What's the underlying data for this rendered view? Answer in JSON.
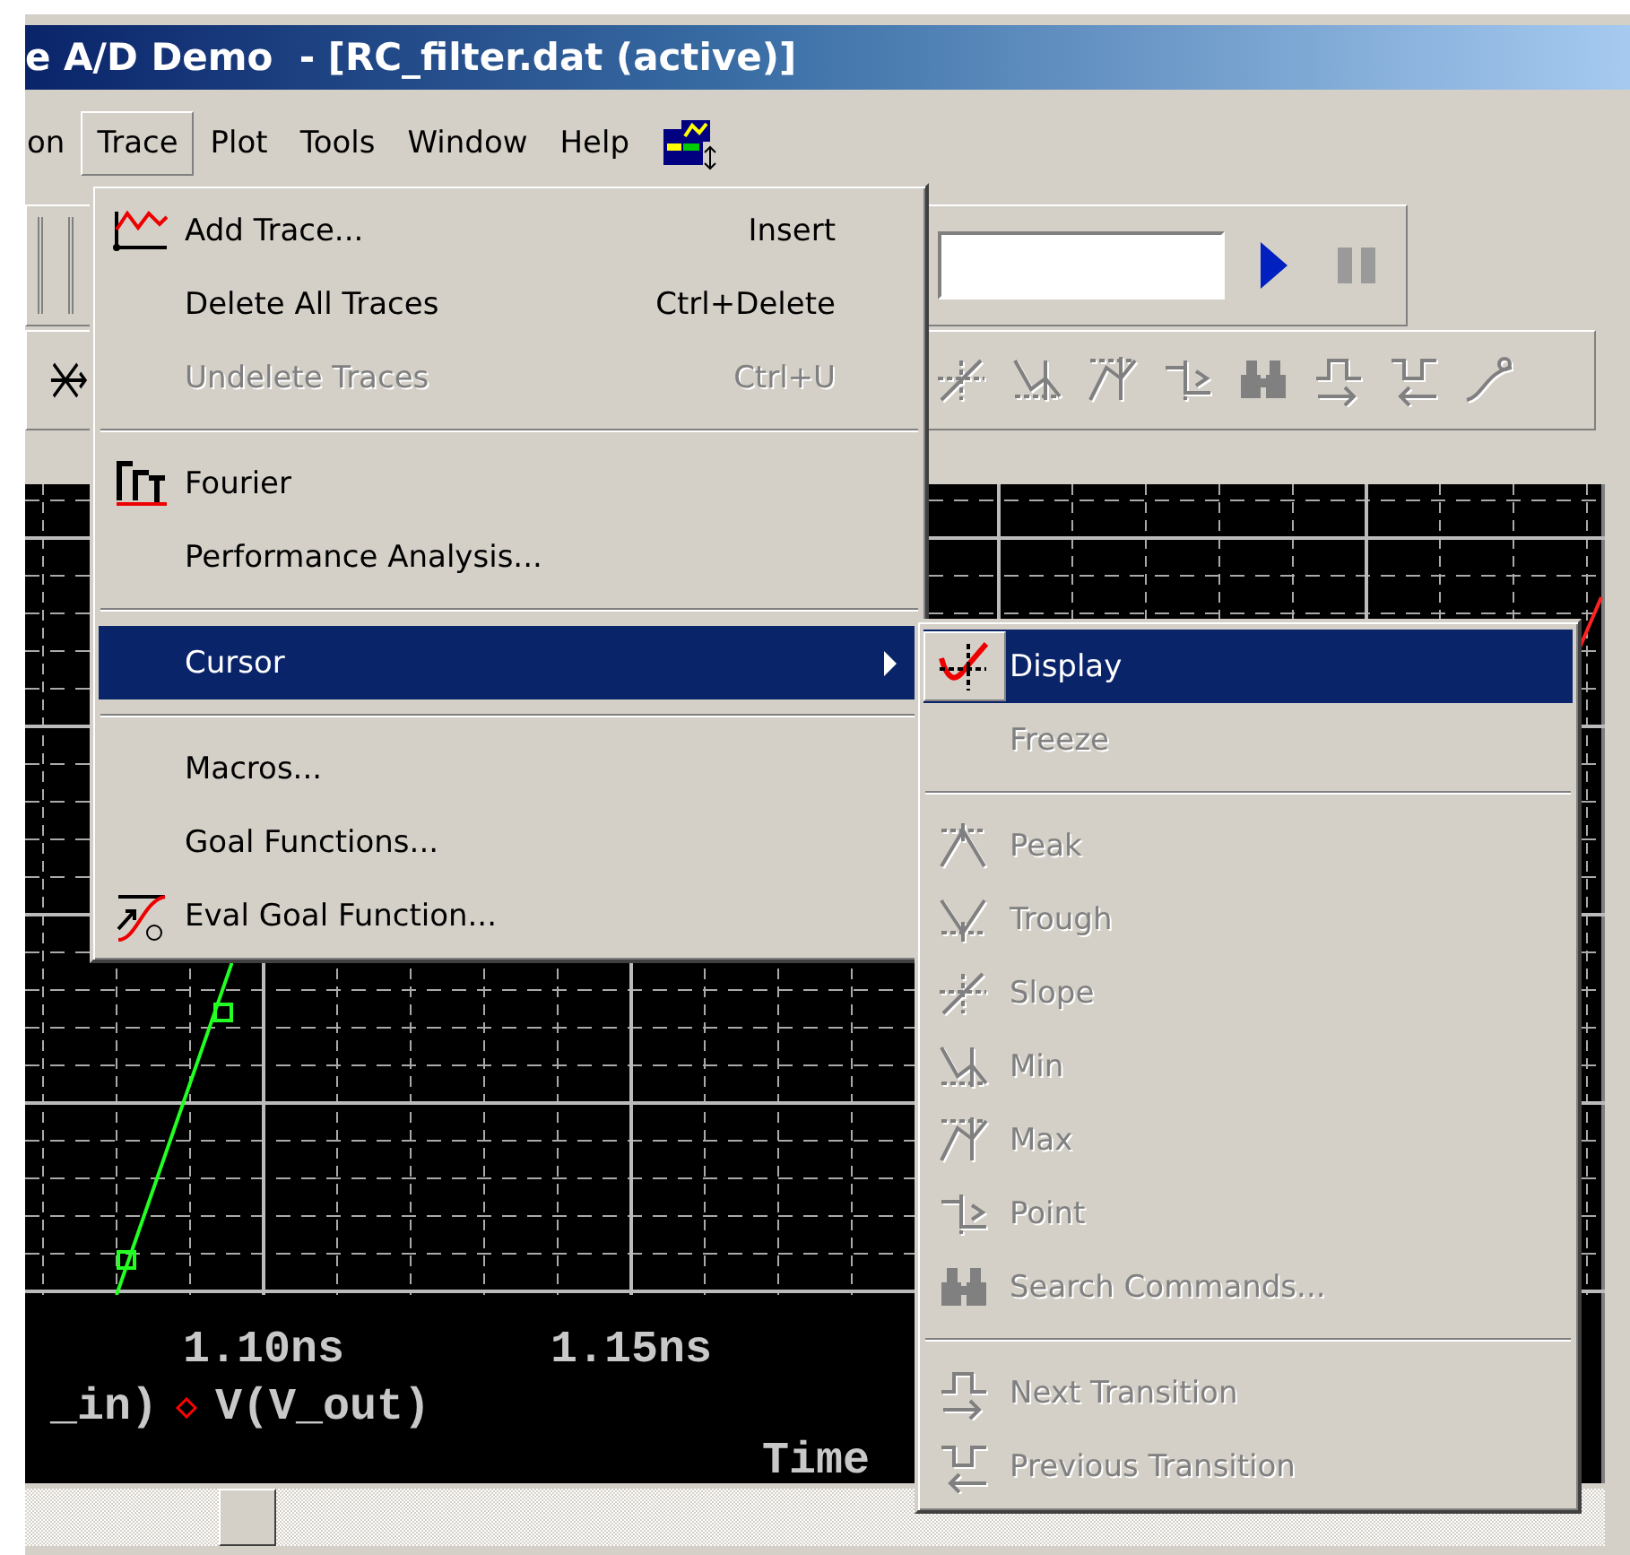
{
  "window": {
    "title": "e A/D Demo  - [RC_filter.dat (active)]"
  },
  "menu_bar": [
    {
      "label": "on",
      "selected": false
    },
    {
      "label": "Trace",
      "selected": true
    },
    {
      "label": "Plot",
      "selected": false
    },
    {
      "label": "Tools",
      "selected": false
    },
    {
      "label": "Window",
      "selected": false
    },
    {
      "label": "Help",
      "selected": false
    }
  ],
  "toolbar": {
    "run": {
      "disabled": false
    },
    "pause": {
      "disabled": true
    }
  },
  "plot": {
    "x_tick_labels": [
      "1.10ns",
      "1.15ns"
    ],
    "legend": [
      {
        "label": "_in)"
      },
      {
        "label": "V(V_out)",
        "color": "#ff0000"
      }
    ],
    "axis_title": "Time"
  },
  "trace_menu": {
    "items": [
      {
        "kind": "item",
        "label": "Add Trace...",
        "shortcut": "Insert",
        "disabled": false,
        "selected": false
      },
      {
        "kind": "item",
        "label": "Delete All Traces",
        "shortcut": "Ctrl+Delete",
        "disabled": false,
        "selected": false
      },
      {
        "kind": "item",
        "label": "Undelete Traces",
        "shortcut": "Ctrl+U",
        "disabled": true,
        "selected": false
      },
      {
        "kind": "separator"
      },
      {
        "kind": "item",
        "label": "Fourier",
        "disabled": false,
        "selected": false
      },
      {
        "kind": "item",
        "label": "Performance Analysis...",
        "disabled": false,
        "selected": false
      },
      {
        "kind": "separator"
      },
      {
        "kind": "submenu",
        "label": "Cursor",
        "disabled": false,
        "selected": true
      },
      {
        "kind": "separator"
      },
      {
        "kind": "item",
        "label": "Macros...",
        "disabled": false,
        "selected": false
      },
      {
        "kind": "item",
        "label": "Goal Functions...",
        "disabled": false,
        "selected": false
      },
      {
        "kind": "item",
        "label": "Eval Goal Function...",
        "disabled": false,
        "selected": false
      }
    ]
  },
  "cursor_submenu": {
    "items": [
      {
        "kind": "item",
        "label": "Display",
        "disabled": false,
        "selected": true,
        "checked": true
      },
      {
        "kind": "item",
        "label": "Freeze",
        "disabled": true,
        "selected": false,
        "checked": false
      },
      {
        "kind": "separator"
      },
      {
        "kind": "item",
        "label": "Peak",
        "disabled": true,
        "selected": false,
        "checked": false
      },
      {
        "kind": "item",
        "label": "Trough",
        "disabled": true,
        "selected": false,
        "checked": false
      },
      {
        "kind": "item",
        "label": "Slope",
        "disabled": true,
        "selected": false,
        "checked": false
      },
      {
        "kind": "item",
        "label": "Min",
        "disabled": true,
        "selected": false,
        "checked": false
      },
      {
        "kind": "item",
        "label": "Max",
        "disabled": true,
        "selected": false,
        "checked": false
      },
      {
        "kind": "item",
        "label": "Point",
        "disabled": true,
        "selected": false,
        "checked": false
      },
      {
        "kind": "item",
        "label": "Search Commands...",
        "disabled": true,
        "selected": false,
        "checked": false
      },
      {
        "kind": "separator"
      },
      {
        "kind": "item",
        "label": "Next Transition",
        "disabled": true,
        "selected": false,
        "checked": false
      },
      {
        "kind": "item",
        "label": "Previous Transition",
        "disabled": true,
        "selected": false,
        "checked": false
      }
    ]
  }
}
